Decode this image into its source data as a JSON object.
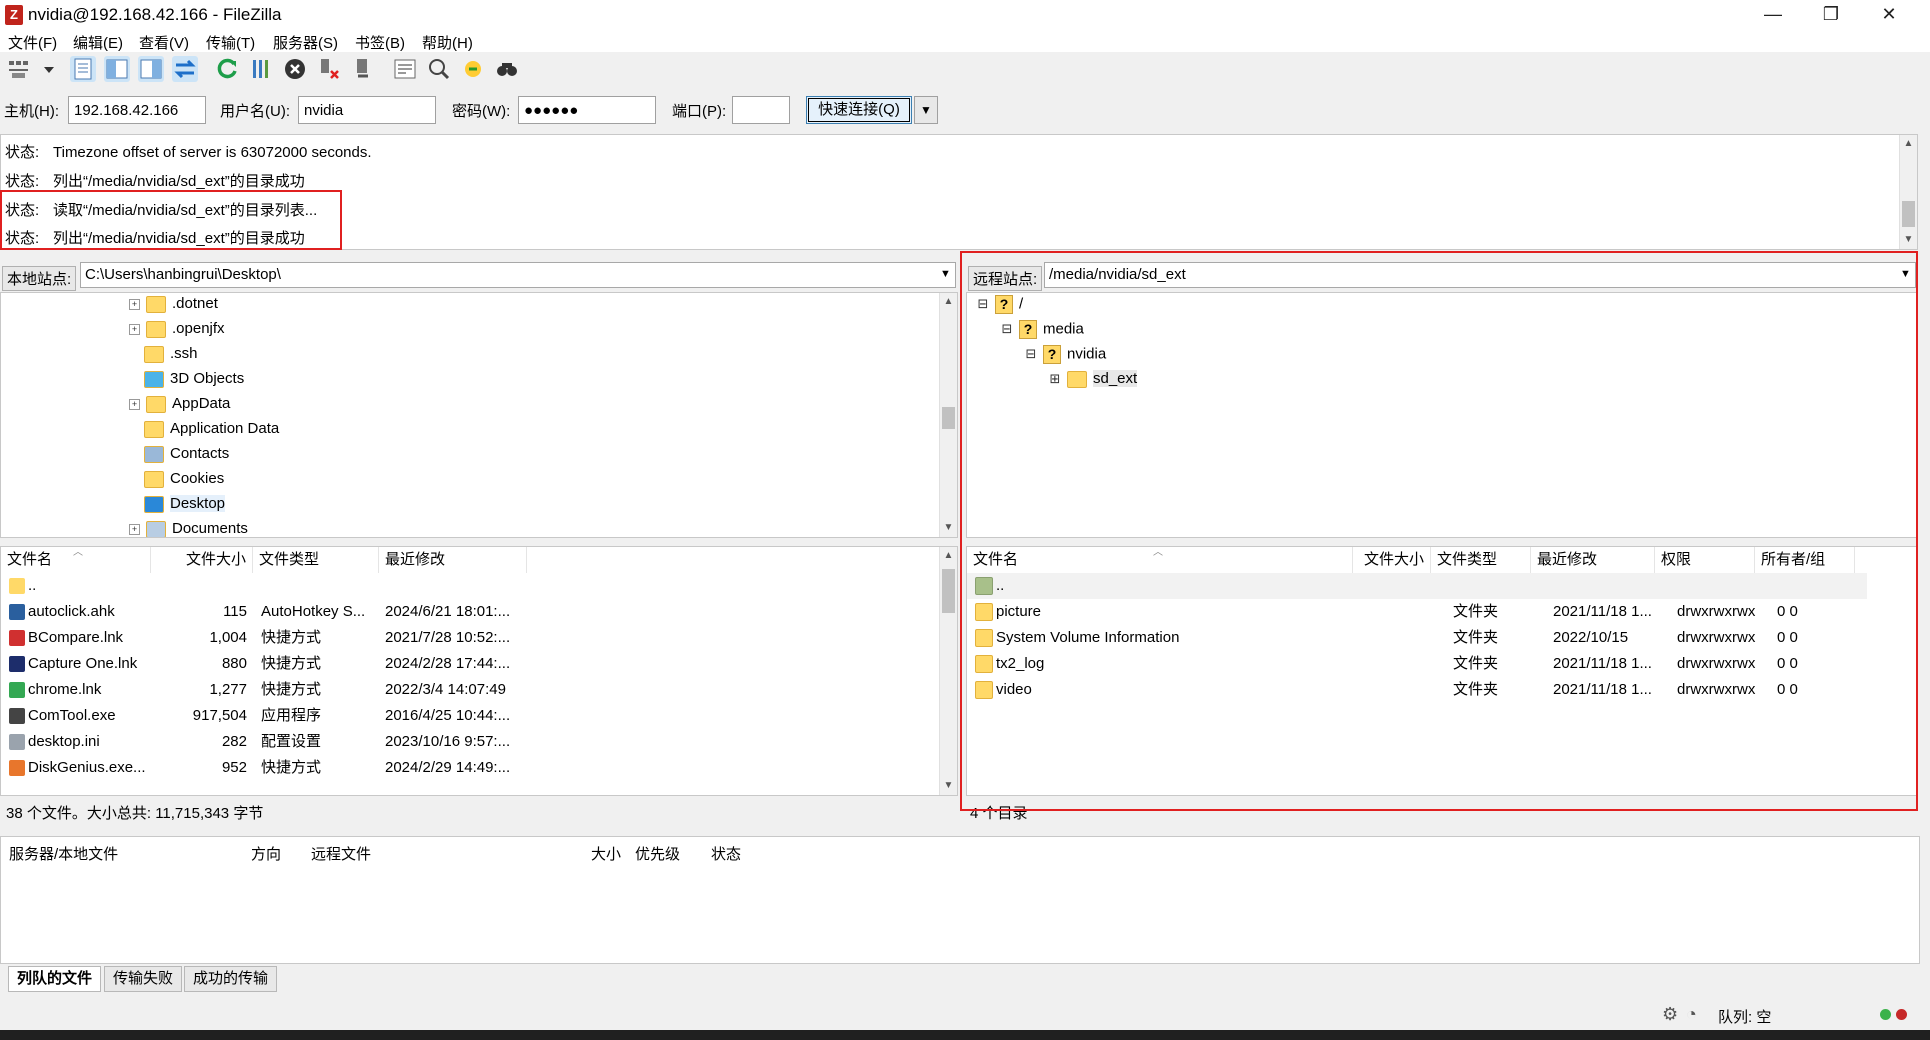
{
  "window": {
    "title": "nvidia@192.168.42.166 - FileZilla",
    "app_icon": "Z"
  },
  "window_controls": {
    "minimize": "—",
    "maximize": "❐",
    "close": "✕"
  },
  "menu": [
    "文件(F)",
    "编辑(E)",
    "查看(V)",
    "传输(T)",
    "服务器(S)",
    "书签(B)",
    "帮助(H)"
  ],
  "toolbar_icons": [
    "site-manager-icon",
    "dropdown-arrow-icon",
    "toggle-log-icon",
    "toggle-local-tree-icon",
    "toggle-remote-tree-icon",
    "toggle-queue-icon",
    "refresh-icon",
    "process-queue-icon",
    "cancel-icon",
    "disconnect-icon",
    "reconnect-icon",
    "filter-icon",
    "compare-icon",
    "sync-browse-icon",
    "search-icon"
  ],
  "quickconnect": {
    "host_label": "主机(H):",
    "host_value": "192.168.42.166",
    "user_label": "用户名(U):",
    "user_value": "nvidia",
    "pass_label": "密码(W):",
    "pass_value": "●●●●●●",
    "port_label": "端口(P):",
    "port_value": "",
    "connect_label": "快速连接(Q)",
    "dropdown": "▼"
  },
  "log": [
    {
      "label": "状态:",
      "text": "Timezone offset of server is 63072000 seconds."
    },
    {
      "label": "状态:",
      "text": "列出“/media/nvidia/sd_ext”的目录成功"
    },
    {
      "label": "状态:",
      "text": "读取“/media/nvidia/sd_ext”的目录列表..."
    },
    {
      "label": "状态:",
      "text": "列出“/media/nvidia/sd_ext”的目录成功"
    }
  ],
  "local": {
    "site_label": "本地站点:",
    "path": "C:\\Users\\hanbingrui\\Desktop\\",
    "tree": [
      {
        "name": ".dotnet",
        "expandable": true,
        "icon": "folder"
      },
      {
        "name": ".openjfx",
        "expandable": true,
        "icon": "folder"
      },
      {
        "name": ".ssh",
        "expandable": false,
        "icon": "folder"
      },
      {
        "name": "3D Objects",
        "expandable": false,
        "icon": "3d-objects"
      },
      {
        "name": "AppData",
        "expandable": true,
        "icon": "folder"
      },
      {
        "name": "Application Data",
        "expandable": false,
        "icon": "folder"
      },
      {
        "name": "Contacts",
        "expandable": false,
        "icon": "contacts"
      },
      {
        "name": "Cookies",
        "expandable": false,
        "icon": "folder"
      },
      {
        "name": "Desktop",
        "expandable": false,
        "icon": "desktop"
      },
      {
        "name": "Documents",
        "expandable": true,
        "icon": "documents"
      }
    ],
    "columns": [
      "文件名",
      "文件大小",
      "文件类型",
      "最近修改"
    ],
    "files": [
      {
        "name": "..",
        "size": "",
        "type": "",
        "modified": "",
        "icon": "#ffd968"
      },
      {
        "name": "autoclick.ahk",
        "size": "115",
        "type": "AutoHotkey S...",
        "modified": "2024/6/21 18:01:...",
        "icon": "#2a5f9e"
      },
      {
        "name": "BCompare.lnk",
        "size": "1,004",
        "type": "快捷方式",
        "modified": "2021/7/28 10:52:...",
        "icon": "#d03030"
      },
      {
        "name": "Capture One.lnk",
        "size": "880",
        "type": "快捷方式",
        "modified": "2024/2/28 17:44:...",
        "icon": "#1d2d6b"
      },
      {
        "name": "chrome.lnk",
        "size": "1,277",
        "type": "快捷方式",
        "modified": "2022/3/4 14:07:49",
        "icon": "#34a853"
      },
      {
        "name": "ComTool.exe",
        "size": "917,504",
        "type": "应用程序",
        "modified": "2016/4/25 10:44:...",
        "icon": "#444444"
      },
      {
        "name": "desktop.ini",
        "size": "282",
        "type": "配置设置",
        "modified": "2023/10/16 9:57:...",
        "icon": "#9aa3ad"
      },
      {
        "name": "DiskGenius.exe...",
        "size": "952",
        "type": "快捷方式",
        "modified": "2024/2/29 14:49:...",
        "icon": "#e8762c"
      }
    ],
    "status": "38 个文件。大小总共: 11,715,343 字节"
  },
  "remote": {
    "site_label": "远程站点:",
    "path": "/media/nvidia/sd_ext",
    "tree": [
      {
        "name": "/",
        "level": 0,
        "expander": "⊟",
        "icon": "question"
      },
      {
        "name": "media",
        "level": 1,
        "expander": "⊟",
        "icon": "question"
      },
      {
        "name": "nvidia",
        "level": 2,
        "expander": "⊟",
        "icon": "question"
      },
      {
        "name": "sd_ext",
        "level": 3,
        "expander": "⊞",
        "icon": "folder"
      }
    ],
    "columns": [
      "文件名",
      "文件大小",
      "文件类型",
      "最近修改",
      "权限",
      "所有者/组"
    ],
    "files": [
      {
        "name": "..",
        "size": "",
        "type": "",
        "modified": "",
        "perm": "",
        "owner": ""
      },
      {
        "name": "picture",
        "size": "",
        "type": "文件夹",
        "modified": "2021/11/18 1...",
        "perm": "drwxrwxrwx",
        "owner": "0 0"
      },
      {
        "name": "System Volume Information",
        "size": "",
        "type": "文件夹",
        "modified": "2022/10/15",
        "perm": "drwxrwxrwx",
        "owner": "0 0"
      },
      {
        "name": "tx2_log",
        "size": "",
        "type": "文件夹",
        "modified": "2021/11/18 1...",
        "perm": "drwxrwxrwx",
        "owner": "0 0"
      },
      {
        "name": "video",
        "size": "",
        "type": "文件夹",
        "modified": "2021/11/18 1...",
        "perm": "drwxrwxrwx",
        "owner": "0 0"
      }
    ],
    "status": "4 个目录"
  },
  "queue": {
    "columns": [
      "服务器/本地文件",
      "方向",
      "远程文件",
      "大小",
      "优先级",
      "状态"
    ],
    "tabs": [
      "列队的文件",
      "传输失败",
      "成功的传输"
    ]
  },
  "statusbar": {
    "queue_label": "队列: 空"
  }
}
